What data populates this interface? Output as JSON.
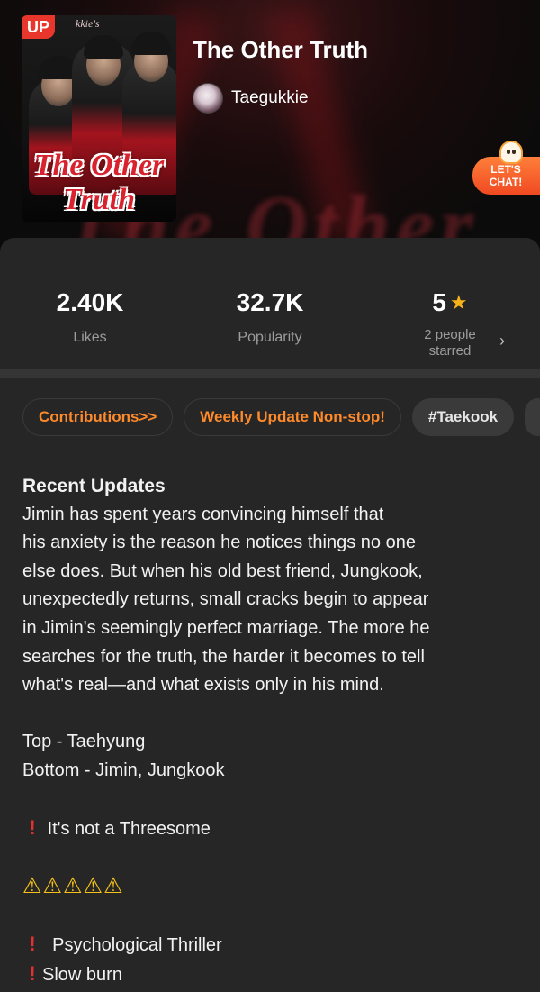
{
  "header": {
    "cover": {
      "badge": "UP",
      "watermark": "kkie's",
      "title_line1": "The Other",
      "title_line2": "Truth"
    },
    "background_text": "The Other",
    "title": "The Other Truth",
    "author": "Taegukkie",
    "chat_badge": {
      "line1": "LET'S",
      "line2": "CHAT!"
    }
  },
  "stats": {
    "likes": {
      "value": "2.40K",
      "label": "Likes"
    },
    "popularity": {
      "value": "32.7K",
      "label": "Popularity"
    },
    "rating": {
      "value": "5",
      "label_line1": "2 people",
      "label_line2": "starred"
    }
  },
  "tags": [
    "Contributions>>",
    "Weekly Update Non-stop!",
    "#Taekook"
  ],
  "description": {
    "heading": "Recent Updates",
    "summary": [
      "Jimin has spent years convincing himself that",
      "his anxiety is the reason he notices things no one",
      "else does. But when his old best friend, Jungkook,",
      "unexpectedly returns, small cracks begin to appear",
      "in Jimin's seemingly perfect marriage. The more he",
      "searches for the truth, the harder it becomes to tell",
      "what's real—and what exists only in his mind."
    ],
    "top": "Top - Taehyung",
    "bottom": "Bottom - Jimin, Jungkook",
    "note": "It's not a Threesome",
    "warnings": "⚠⚠⚠⚠⚠",
    "genre1": "Psychological Thriller",
    "genre2": "Slow burn"
  },
  "colors": {
    "accent": "#ff8a2a",
    "panel": "#262626",
    "star": "#f6b21a"
  }
}
